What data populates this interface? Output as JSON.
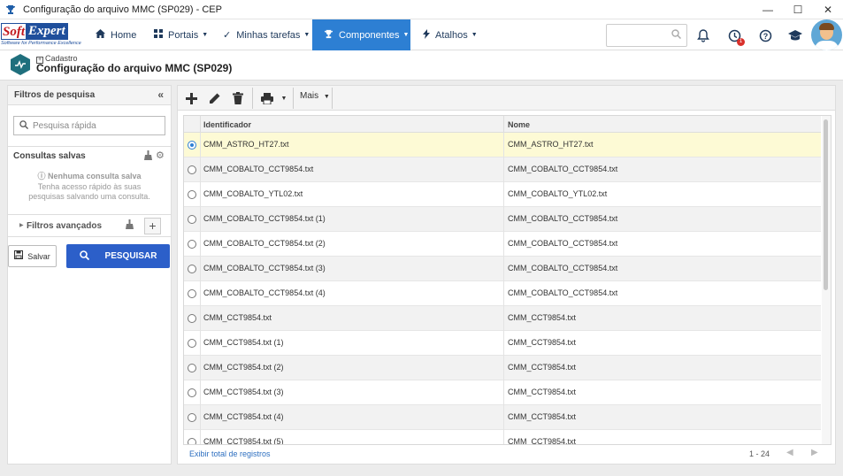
{
  "window": {
    "title": "Configuração do arquivo MMC (SP029) - CEP"
  },
  "brand": {
    "soft": "Soft",
    "expert": "Expert",
    "tagline": "Software for Performance Excellence"
  },
  "nav": {
    "home": "Home",
    "portais": "Portais",
    "tarefas": "Minhas tarefas",
    "componentes": "Componentes",
    "atalhos": "Atalhos",
    "notification_count": "1"
  },
  "page": {
    "breadcrumb": "Cadastro",
    "title": "Configuração do arquivo MMC (SP029)"
  },
  "filters": {
    "header": "Filtros de pesquisa",
    "quick_search_placeholder": "Pesquisa rápida",
    "saved_title": "Consultas salvas",
    "empty_title": "Nenhuma consulta salva",
    "empty_text": "Tenha acesso rápido às suas pesquisas salvando uma consulta.",
    "advanced": "Filtros avançados",
    "save_label": "Salvar",
    "search_label": "PESQUISAR"
  },
  "toolbar": {
    "more_label": "Mais"
  },
  "grid": {
    "columns": [
      "Identificador",
      "Nome"
    ],
    "rows": [
      {
        "id": "CMM_ASTRO_HT27.txt",
        "name": "CMM_ASTRO_HT27.txt",
        "selected": true
      },
      {
        "id": "CMM_COBALTO_CCT9854.txt",
        "name": "CMM_COBALTO_CCT9854.txt"
      },
      {
        "id": "CMM_COBALTO_YTL02.txt",
        "name": "CMM_COBALTO_YTL02.txt"
      },
      {
        "id": "CMM_COBALTO_CCT9854.txt (1)",
        "name": "CMM_COBALTO_CCT9854.txt"
      },
      {
        "id": "CMM_COBALTO_CCT9854.txt (2)",
        "name": "CMM_COBALTO_CCT9854.txt"
      },
      {
        "id": "CMM_COBALTO_CCT9854.txt (3)",
        "name": "CMM_COBALTO_CCT9854.txt"
      },
      {
        "id": "CMM_COBALTO_CCT9854.txt (4)",
        "name": "CMM_COBALTO_CCT9854.txt"
      },
      {
        "id": "CMM_CCT9854.txt",
        "name": "CMM_CCT9854.txt"
      },
      {
        "id": "CMM_CCT9854.txt (1)",
        "name": "CMM_CCT9854.txt"
      },
      {
        "id": "CMM_CCT9854.txt (2)",
        "name": "CMM_CCT9854.txt"
      },
      {
        "id": "CMM_CCT9854.txt (3)",
        "name": "CMM_CCT9854.txt"
      },
      {
        "id": "CMM_CCT9854.txt (4)",
        "name": "CMM_CCT9854.txt"
      },
      {
        "id": "CMM_CCT9854.txt (5)",
        "name": "CMM_CCT9854.txt"
      }
    ],
    "footer_link": "Exibir total de registros",
    "range": "1 - 24"
  },
  "colors": {
    "accent": "#2d7fd3",
    "primary_button": "#2c5fc9",
    "selected_row": "#fdfad5",
    "brand_red": "#c2161c",
    "brand_blue": "#1f4f9c"
  },
  "icons": [
    "trophy-icon",
    "home-icon",
    "grid-icon",
    "check-icon",
    "trophy-icon",
    "bolt-icon",
    "search-icon",
    "bell-icon",
    "clock-icon",
    "help-icon",
    "graduation-icon",
    "avatar",
    "add-icon",
    "edit-icon",
    "trash-icon",
    "print-icon",
    "gear-icon"
  ]
}
